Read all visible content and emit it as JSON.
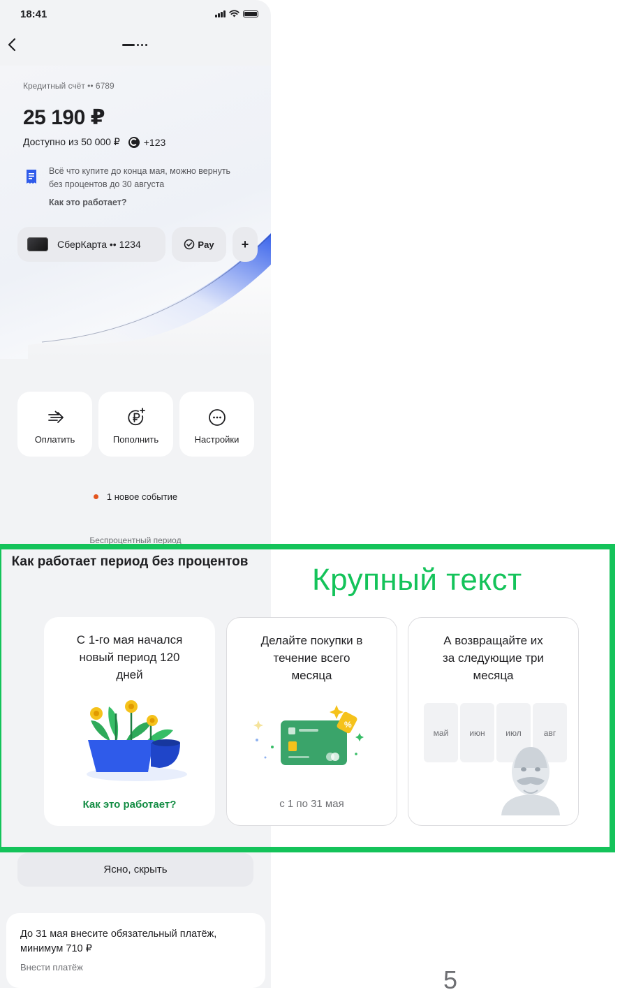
{
  "status_bar": {
    "time": "18:41"
  },
  "account": {
    "label": "Кредитный счёт •• 6789",
    "balance": "25 190 ₽",
    "available": "Доступно из 50 000 ₽",
    "bonus": "+123",
    "notice": "Всё что купите до конца мая, можно вернуть без процентов до 30 августа",
    "notice_link": "Как это работает?"
  },
  "chips": {
    "card": "СберКарта •• 1234",
    "pay": "Pay",
    "add": "+"
  },
  "actions": [
    {
      "label": "Оплатить",
      "icon": "pay-arrow-icon"
    },
    {
      "label": "Пополнить",
      "icon": "ruble-plus-icon"
    },
    {
      "label": "Настройки",
      "icon": "more-dots-icon"
    }
  ],
  "event": "1 новое событие",
  "period_label": "Беспроцентный период",
  "overlay": {
    "title": "Как работает период без процентов",
    "heading": "Крупный текст",
    "cards": [
      {
        "text": "С 1-го мая начался новый период 120 дней",
        "footer": "Как это работает?",
        "art": "flowers-pot-illustration"
      },
      {
        "text": "Делайте покупки в течение всего месяца",
        "footer": "с 1 по 31 мая",
        "art": "green-card-illustration"
      },
      {
        "text": "А возвращайте их за следующие три месяца",
        "months": [
          "май",
          "июн",
          "июл",
          "авг"
        ],
        "art": "mascot-illustration"
      }
    ]
  },
  "hide_button": "Ясно, скрыть",
  "payment": {
    "title": "До 31 мая внесите обязательный платёж, минимум 710 ₽",
    "link": "Внести платёж"
  },
  "page_number": "5",
  "colors": {
    "accent_green": "#14c35a",
    "link_green": "#128c43",
    "event_dot": "#e3541d",
    "hero_blue": "#2f5bea"
  }
}
